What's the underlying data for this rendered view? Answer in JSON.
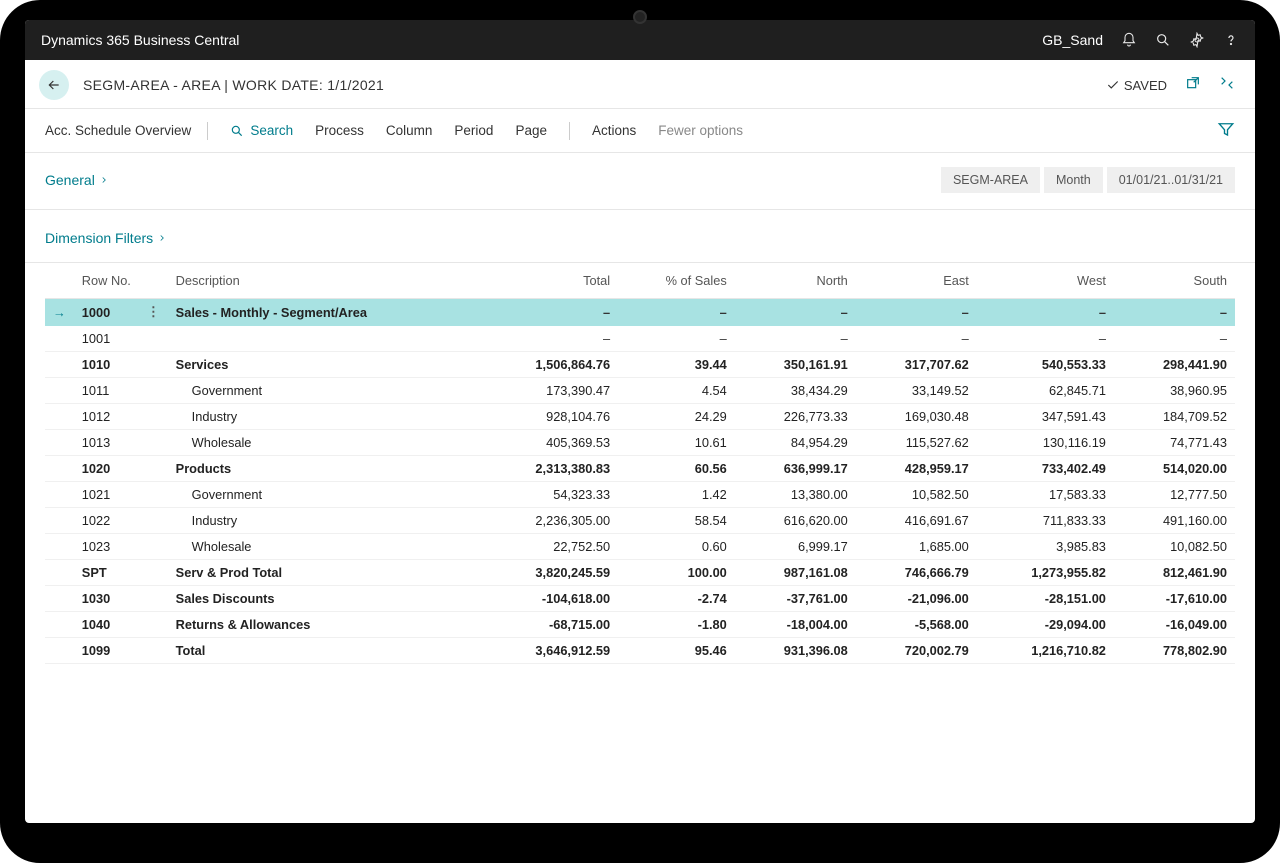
{
  "topbar": {
    "app_name": "Dynamics 365 Business Central",
    "env_name": "GB_Sand"
  },
  "header": {
    "title": "SEGM-AREA - AREA | WORK DATE: 1/1/2021",
    "saved_label": "SAVED"
  },
  "actionbar": {
    "title": "Acc. Schedule Overview",
    "search_label": "Search",
    "items": [
      "Process",
      "Column",
      "Period",
      "Page"
    ],
    "actions_label": "Actions",
    "fewer_label": "Fewer options"
  },
  "general": {
    "label": "General",
    "pills": [
      "SEGM-AREA",
      "Month",
      "01/01/21..01/31/21"
    ]
  },
  "dimension_filters": {
    "label": "Dimension Filters"
  },
  "table": {
    "headers": [
      "Row No.",
      "Description",
      "Total",
      "% of Sales",
      "North",
      "East",
      "West",
      "South"
    ],
    "rows": [
      {
        "rowno": "1000",
        "desc": "Sales - Monthly - Segment/Area",
        "bold": true,
        "selected": true,
        "dash": true,
        "indent": 0,
        "vals": [
          "–",
          "–",
          "–",
          "–",
          "–",
          "–"
        ]
      },
      {
        "rowno": "1001",
        "desc": "",
        "bold": false,
        "dash": true,
        "indent": 0,
        "vals": [
          "–",
          "–",
          "–",
          "–",
          "–",
          "–"
        ]
      },
      {
        "rowno": "1010",
        "desc": "Services",
        "bold": true,
        "indent": 0,
        "vals": [
          "1,506,864.76",
          "39.44",
          "350,161.91",
          "317,707.62",
          "540,553.33",
          "298,441.90"
        ]
      },
      {
        "rowno": "1011",
        "desc": "Government",
        "bold": false,
        "indent": 1,
        "vals": [
          "173,390.47",
          "4.54",
          "38,434.29",
          "33,149.52",
          "62,845.71",
          "38,960.95"
        ]
      },
      {
        "rowno": "1012",
        "desc": "Industry",
        "bold": false,
        "indent": 1,
        "vals": [
          "928,104.76",
          "24.29",
          "226,773.33",
          "169,030.48",
          "347,591.43",
          "184,709.52"
        ]
      },
      {
        "rowno": "1013",
        "desc": "Wholesale",
        "bold": false,
        "indent": 1,
        "vals": [
          "405,369.53",
          "10.61",
          "84,954.29",
          "115,527.62",
          "130,116.19",
          "74,771.43"
        ]
      },
      {
        "rowno": "1020",
        "desc": "Products",
        "bold": true,
        "indent": 0,
        "vals": [
          "2,313,380.83",
          "60.56",
          "636,999.17",
          "428,959.17",
          "733,402.49",
          "514,020.00"
        ]
      },
      {
        "rowno": "1021",
        "desc": "Government",
        "bold": false,
        "indent": 1,
        "vals": [
          "54,323.33",
          "1.42",
          "13,380.00",
          "10,582.50",
          "17,583.33",
          "12,777.50"
        ]
      },
      {
        "rowno": "1022",
        "desc": "Industry",
        "bold": false,
        "indent": 1,
        "vals": [
          "2,236,305.00",
          "58.54",
          "616,620.00",
          "416,691.67",
          "711,833.33",
          "491,160.00"
        ]
      },
      {
        "rowno": "1023",
        "desc": "Wholesale",
        "bold": false,
        "indent": 1,
        "vals": [
          "22,752.50",
          "0.60",
          "6,999.17",
          "1,685.00",
          "3,985.83",
          "10,082.50"
        ]
      },
      {
        "rowno": "SPT",
        "desc": "Serv & Prod Total",
        "bold": true,
        "indent": 0,
        "vals": [
          "3,820,245.59",
          "100.00",
          "987,161.08",
          "746,666.79",
          "1,273,955.82",
          "812,461.90"
        ]
      },
      {
        "rowno": "1030",
        "desc": "Sales Discounts",
        "bold": true,
        "indent": 0,
        "vals": [
          "-104,618.00",
          "-2.74",
          "-37,761.00",
          "-21,096.00",
          "-28,151.00",
          "-17,610.00"
        ]
      },
      {
        "rowno": "1040",
        "desc": "Returns & Allowances",
        "bold": true,
        "indent": 0,
        "vals": [
          "-68,715.00",
          "-1.80",
          "-18,004.00",
          "-5,568.00",
          "-29,094.00",
          "-16,049.00"
        ]
      },
      {
        "rowno": "1099",
        "desc": "Total",
        "bold": true,
        "indent": 0,
        "vals": [
          "3,646,912.59",
          "95.46",
          "931,396.08",
          "720,002.79",
          "1,216,710.82",
          "778,802.90"
        ]
      }
    ]
  }
}
